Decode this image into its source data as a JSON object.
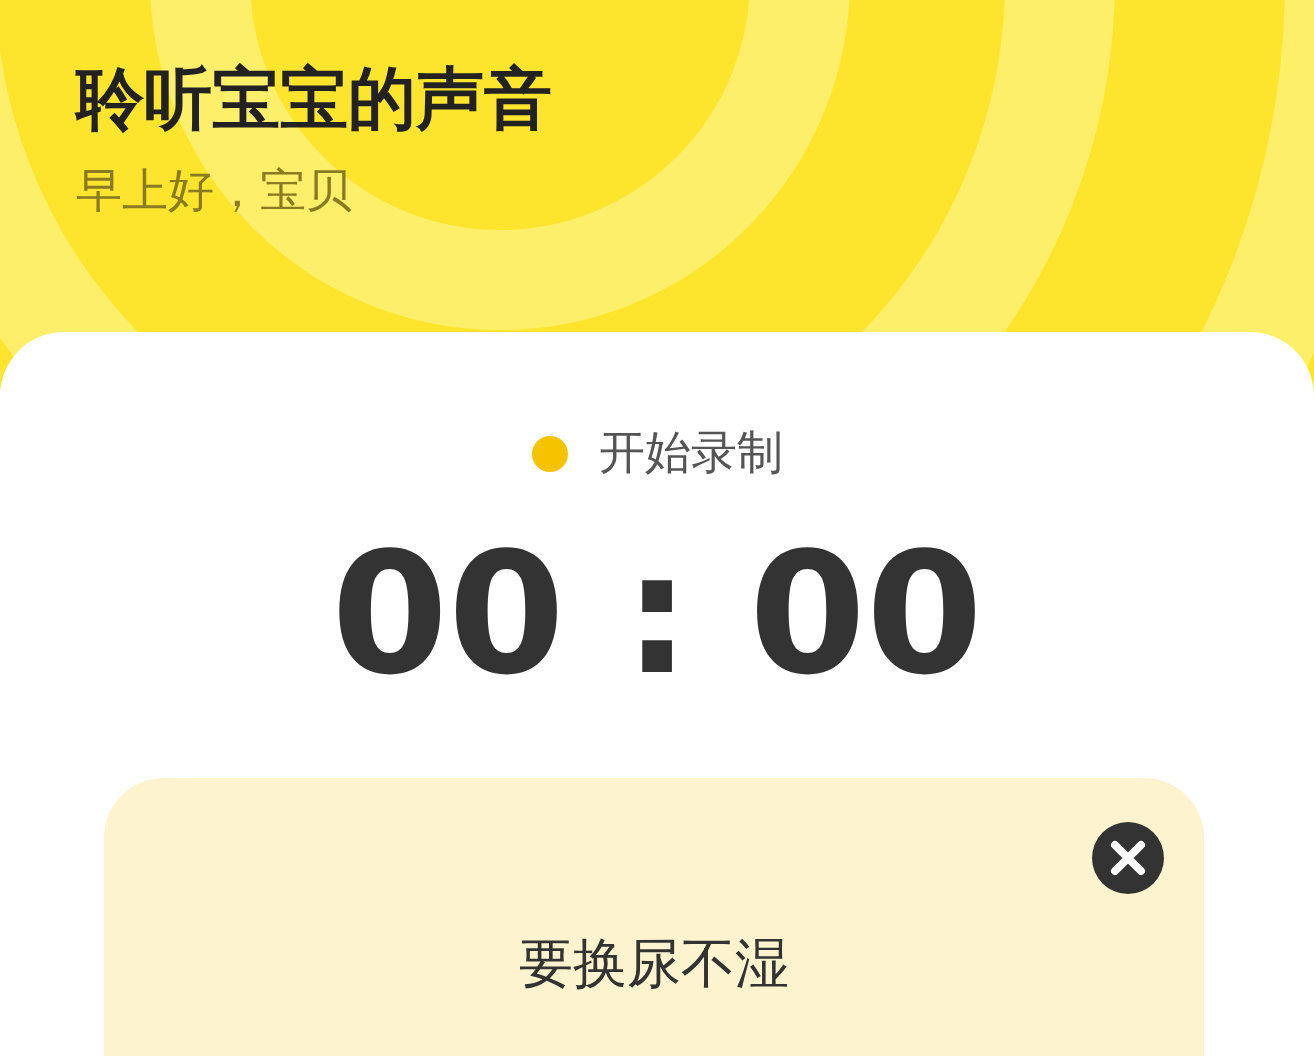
{
  "header": {
    "title": "聆听宝宝的声音",
    "greeting": "早上好，宝贝"
  },
  "recorder": {
    "status": "开始录制",
    "timer": "00 : 00"
  },
  "prompt_card": {
    "text": "要换尿不湿",
    "closable": true
  }
}
